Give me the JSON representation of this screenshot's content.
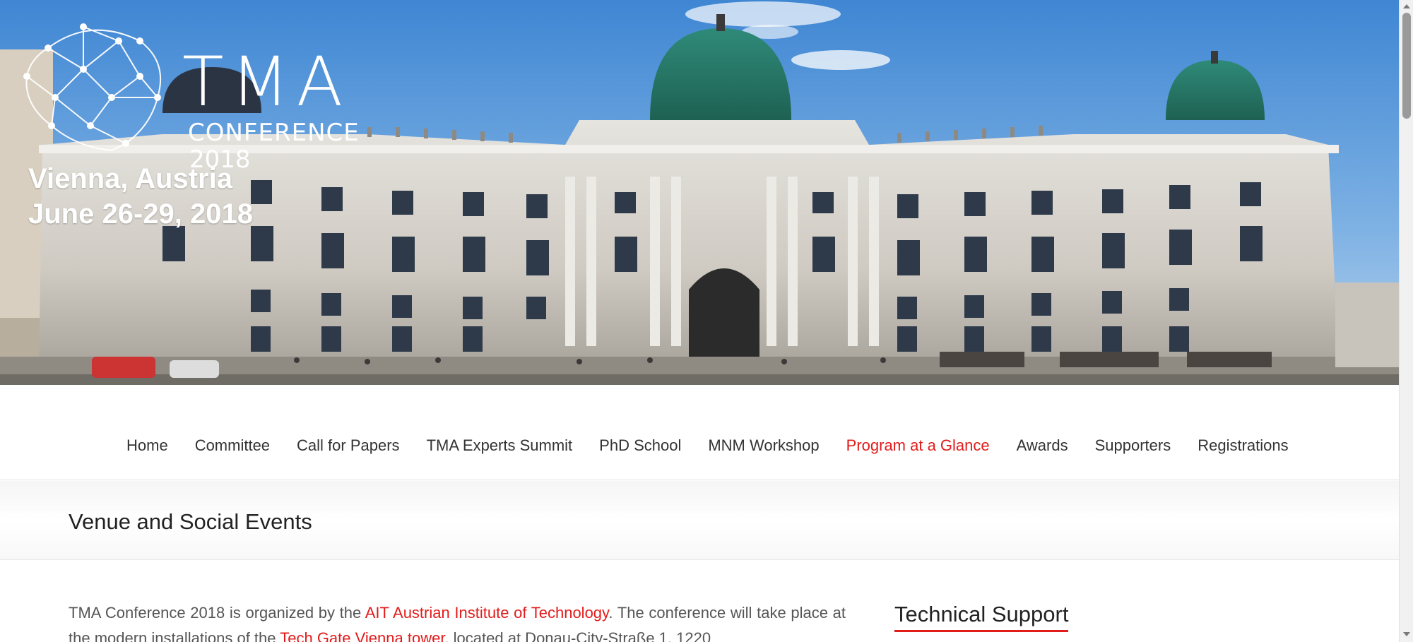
{
  "hero": {
    "logo_title": "TMA",
    "logo_subtitle": "CONFERENCE",
    "logo_year": "2018",
    "location": "Vienna, Austria",
    "dates": "June 26-29, 2018"
  },
  "nav": {
    "items": [
      {
        "label": "Home"
      },
      {
        "label": "Committee"
      },
      {
        "label": "Call for Papers"
      },
      {
        "label": "TMA Experts Summit"
      },
      {
        "label": "PhD School"
      },
      {
        "label": "MNM Workshop"
      },
      {
        "label": "Program at a Glance"
      },
      {
        "label": "Awards"
      },
      {
        "label": "Supporters"
      },
      {
        "label": "Registrations"
      }
    ],
    "active_index": 6
  },
  "page": {
    "title": "Venue and Social Events"
  },
  "content": {
    "p1_part1": "TMA Conference 2018 is organized by the ",
    "p1_link1": "AIT Austrian Institute of Technology",
    "p1_part2": ". The conference will take place at the modern installations of the ",
    "p1_link2": "Tech Gate Vienna tower",
    "p1_part3": ", located at Donau-City-Straße 1, 1220"
  },
  "sidebar": {
    "heading": "Technical Support"
  },
  "colors": {
    "accent": "#e21b1b",
    "text": "#333333",
    "sky": "#4a8fd6"
  }
}
